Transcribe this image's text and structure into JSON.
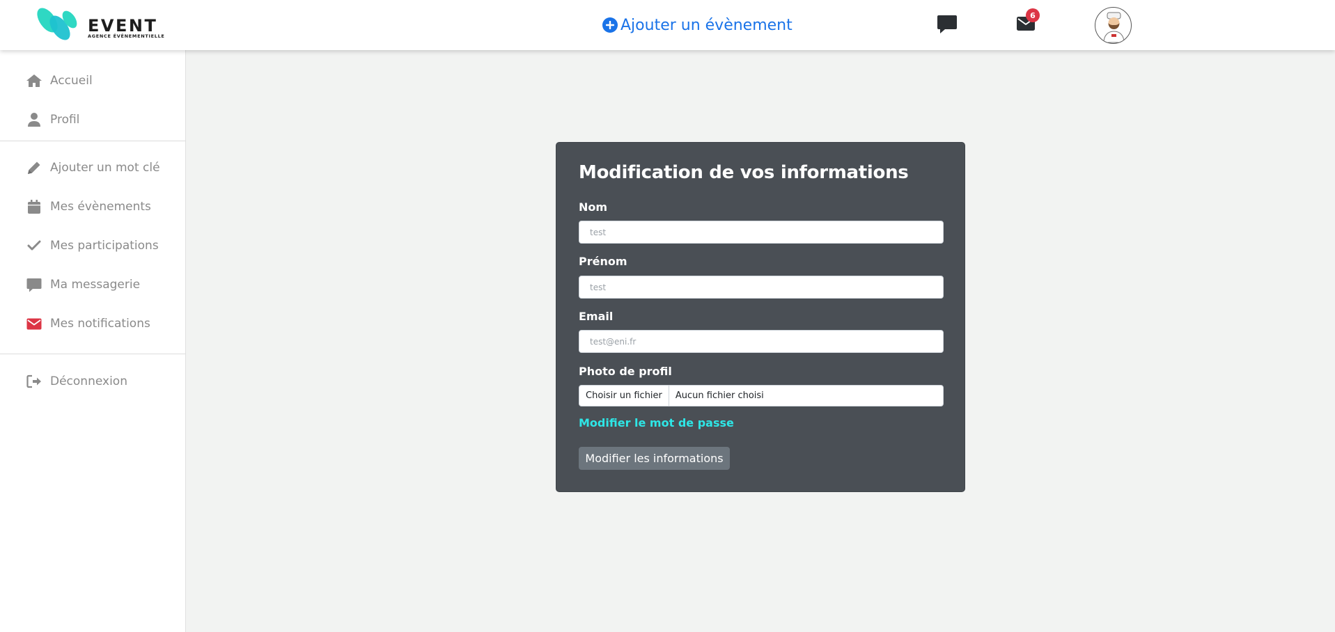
{
  "header": {
    "brand_name": "EVENT",
    "brand_tagline": "AGENCE ÉVÉNEMENTIELLE",
    "add_event_label": "Ajouter un évènement",
    "notification_count": "6",
    "brand_colors": [
      "#2fd8c3",
      "#1fc2d0"
    ],
    "accent_color": "#1a73e8",
    "badge_color": "#dc3545"
  },
  "sidebar": {
    "items": [
      {
        "label": "Accueil",
        "icon": "home-icon"
      },
      {
        "label": "Profil",
        "icon": "user-icon"
      },
      {
        "label": "Ajouter un mot clé",
        "icon": "pencil-icon"
      },
      {
        "label": "Mes évènements",
        "icon": "calendar-icon"
      },
      {
        "label": "Mes participations",
        "icon": "check-icon"
      },
      {
        "label": "Ma messagerie",
        "icon": "chat-icon"
      },
      {
        "label": "Mes notifications",
        "icon": "envelope-icon"
      },
      {
        "label": "Déconnexion",
        "icon": "logout-icon"
      }
    ],
    "icon_color": "#8a8a8a",
    "notification_icon_color": "#dc3545"
  },
  "form": {
    "title": "Modification de vos informations",
    "nom_label": "Nom",
    "nom_placeholder": "test",
    "prenom_label": "Prénom",
    "prenom_placeholder": "test",
    "email_label": "Email",
    "email_placeholder": "test@eni.fr",
    "photo_label": "Photo de profil",
    "file_button": "Choisir un fichier",
    "file_status": "Aucun fichier choisi",
    "password_link": "Modifier le mot de passe",
    "submit_label": "Modifier les informations",
    "card_color": "#4a4f55",
    "link_color": "#2ee6e6"
  }
}
